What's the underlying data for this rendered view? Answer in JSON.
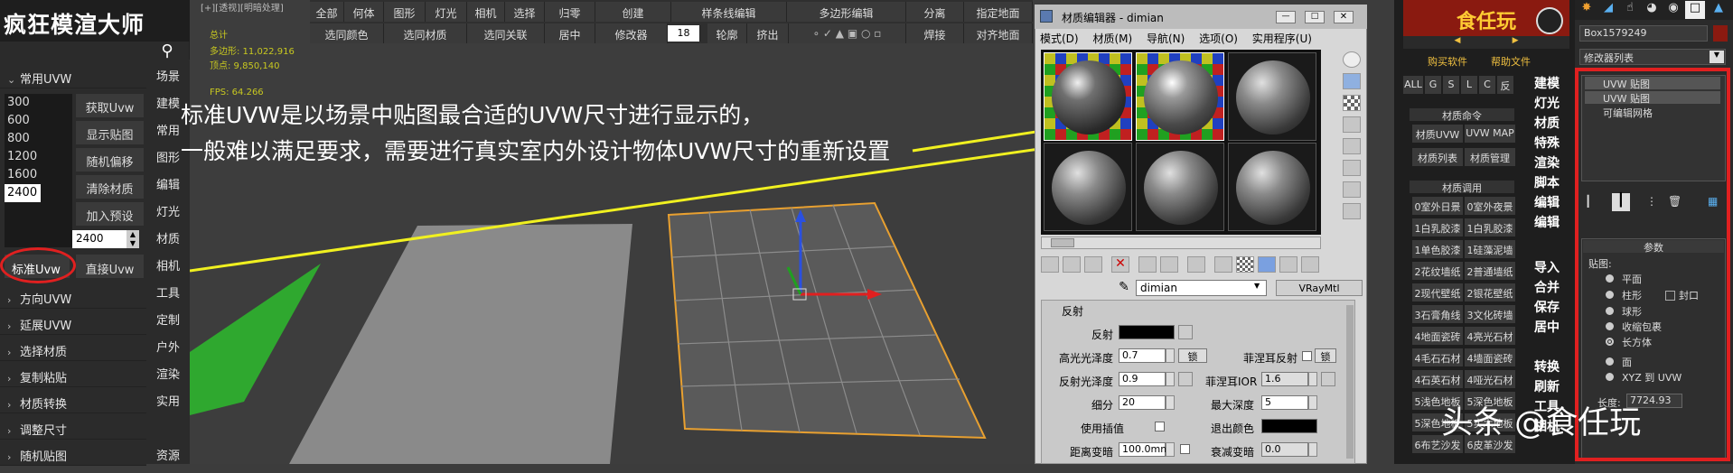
{
  "left_panel": {
    "app_title": "疯狂模渲大师",
    "search_icon": "search-icon",
    "section_common_uvw": "常用UVW",
    "presets": [
      "300",
      "600",
      "800",
      "1200",
      "1600",
      "2400"
    ],
    "buttons": [
      "获取Uvw",
      "显示贴图",
      "随机偏移",
      "清除材质",
      "加入预设"
    ],
    "spinner_value": "2400",
    "std_uvw": "标准Uvw",
    "direct_uvw": "直接Uvw",
    "sections": [
      "方向UVW",
      "延展UVW",
      "选择材质",
      "复制粘贴",
      "材质转换",
      "调整尺寸",
      "随机贴图"
    ],
    "categories": [
      "场景",
      "建模",
      "常用",
      "图形",
      "编辑",
      "灯光",
      "材质",
      "相机",
      "工具",
      "定制",
      "户外",
      "渲染",
      "实用",
      "资源"
    ]
  },
  "viewport": {
    "label": "[+][透视][明暗处理]",
    "stats_total": "总计",
    "stats_poly": "多边形: 11,022,916",
    "stats_vert": "顶点:   9,850,140",
    "stats_fps": "FPS:    64.266",
    "annotation_line1": "标准UVW是以场景中贴图最合适的UVW尺寸进行显示的，",
    "annotation_line2": "一般难以满足要求，需要进行真实室内外设计物体UVW尺寸的重新设置"
  },
  "toolbar": {
    "row1": [
      "全部",
      "何体",
      "图形",
      "灯光",
      "相机",
      "选择",
      "归零",
      "创建",
      "样条线编辑",
      "多边形编辑",
      "分离",
      "指定地面"
    ],
    "row2": [
      "选同颜色",
      "选同材质",
      "选同关联",
      "居中",
      "修改器",
      "18",
      "轮廓",
      "挤出",
      "焊接",
      "对齐地面"
    ]
  },
  "material_editor": {
    "title": "材质编辑器 - dimian",
    "menu": [
      "模式(D)",
      "材质(M)",
      "导航(N)",
      "选项(O)",
      "实用程序(U)"
    ],
    "material_name": "dimian",
    "material_type": "VRayMtl",
    "section": "反射",
    "params": {
      "reflect": "反射",
      "hilight_gloss": "高光光泽度",
      "hilight_gloss_val": "0.7",
      "lock": "锁",
      "fresnel": "菲涅耳反射",
      "refl_gloss": "反射光泽度",
      "refl_gloss_val": "0.9",
      "fresnel_ior": "菲涅耳IOR",
      "fresnel_ior_val": "1.6",
      "subdivs": "细分",
      "subdivs_val": "20",
      "max_depth": "最大深度",
      "max_depth_val": "5",
      "use_interp": "使用插值",
      "exit_color": "退出颜色",
      "dist_dim": "距离变暗",
      "dist_dim_val": "100.0mm",
      "dim_falloff": "衰减变暗",
      "dim_falloff_val": "0.0"
    }
  },
  "library": {
    "logo": "食任玩",
    "buy": "购买软件",
    "help": "帮助文件",
    "filters": [
      "ALL",
      "G",
      "S",
      "L",
      "C",
      "反"
    ],
    "section_cmd": "材质命令",
    "cmd_buttons": [
      "材质UVW",
      "UVW MAP",
      "材质列表",
      "材质管理"
    ],
    "section_ref": "材质调用",
    "materials": [
      [
        "0室外日景",
        "0室外夜景"
      ],
      [
        "1白乳胶漆",
        "1白乳胶漆"
      ],
      [
        "1单色胶漆",
        "1硅藻泥墙"
      ],
      [
        "2花纹墙纸",
        "2普通墙纸"
      ],
      [
        "2现代壁纸",
        "2银花壁纸"
      ],
      [
        "3石膏角线",
        "3文化砖墙"
      ],
      [
        "4地面瓷砖",
        "4亮光石材"
      ],
      [
        "4毛石石材",
        "4墙面瓷砖"
      ],
      [
        "4石英石材",
        "4哑光石材"
      ],
      [
        "5浅色地板",
        "5深色地板"
      ],
      [
        "5深色地板",
        "5实木地板"
      ],
      [
        "6布艺沙发",
        "6皮革沙发"
      ]
    ],
    "right_cats": [
      "建模",
      "灯光",
      "材质",
      "特殊",
      "渲染",
      "脚本",
      "编辑",
      "编辑",
      "导入",
      "合并",
      "保存",
      "居中",
      "转换",
      "刷新",
      "工具",
      "相机"
    ]
  },
  "command_panel": {
    "object_name": "Box1579249",
    "modifier_list": "修改器列表",
    "stack": [
      "UVW 贴图",
      "UVW 贴图",
      "可编辑网格"
    ],
    "rollout_title": "参数",
    "mapping_label": "贴图:",
    "mapping_options": [
      "平面",
      "柱形",
      "球形",
      "收缩包裹",
      "长方体",
      "面",
      "XYZ 到 UVW"
    ],
    "cap_label": "封口",
    "length_label": "长度:",
    "length_value": "7724.93"
  },
  "watermark": "头条 @食任玩",
  "colors": {
    "highlight_red": "#e02020",
    "arrow_yellow": "#f0f020",
    "selection_orange": "#e8a030"
  }
}
